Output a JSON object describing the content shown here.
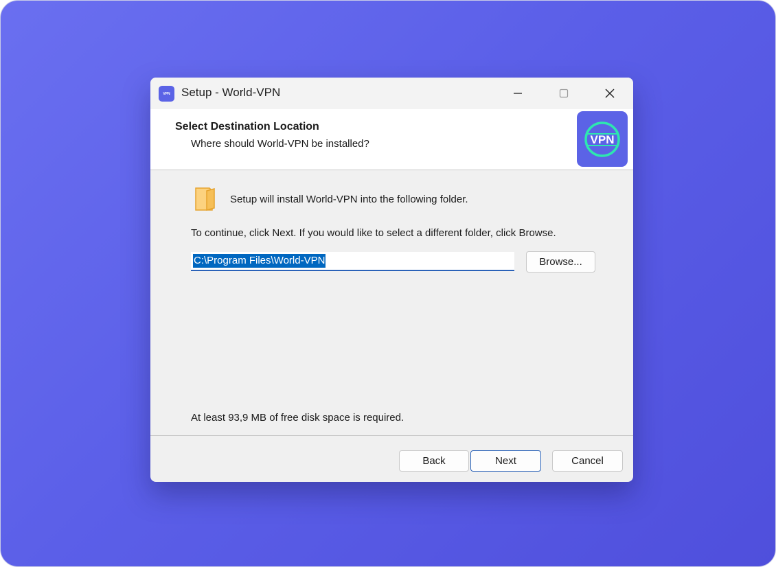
{
  "window": {
    "title": "Setup - World-VPN",
    "icon_text": "VPN"
  },
  "header": {
    "title": "Select Destination Location",
    "subtitle": "Where should World-VPN be installed?",
    "logo_text": "VPN"
  },
  "body": {
    "intro": "Setup will install World-VPN into the following folder.",
    "instruction": "To continue, click Next. If you would like to select a different folder, click Browse.",
    "path_value": "C:\\Program Files\\World-VPN",
    "browse_label": "Browse...",
    "disk_space": "At least 93,9 MB of free disk space is required."
  },
  "footer": {
    "back_label": "Back",
    "next_label": "Next",
    "cancel_label": "Cancel"
  },
  "colors": {
    "accent": "#5b63e6",
    "selection": "#0067c0",
    "logo_ring": "#2ee6b0"
  }
}
